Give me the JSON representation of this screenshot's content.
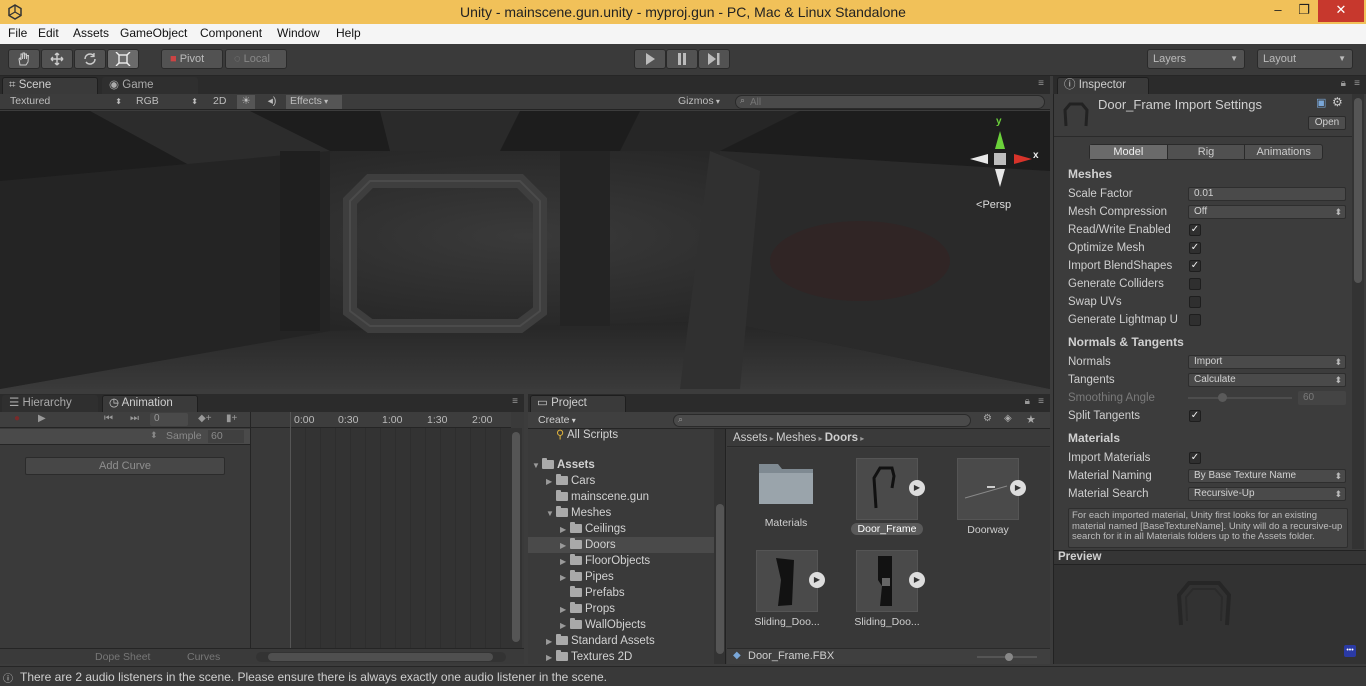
{
  "window": {
    "title": "Unity - mainscene.gun.unity - myproj.gun - PC, Mac & Linux Standalone",
    "min": "–",
    "max": "❐",
    "close": "✕"
  },
  "menu": [
    "File",
    "Edit",
    "Assets",
    "GameObject",
    "Component",
    "Window",
    "Help"
  ],
  "toolbar": {
    "pivot": "Pivot",
    "local": "Local",
    "layers": "Layers",
    "layout": "Layout"
  },
  "scene": {
    "tabs": {
      "scene": "Scene",
      "game": "Game"
    },
    "render_mode": "Textured",
    "color_mode": "RGB",
    "mode2d": "2D",
    "effects": "Effects",
    "gizmos": "Gizmos",
    "search_placeholder": "All",
    "persp": "Persp",
    "axis_x": "x",
    "axis_y": "y"
  },
  "animation": {
    "tabs": {
      "hierarchy": "Hierarchy",
      "animation": "Animation"
    },
    "frame": "0",
    "sample_label": "Sample",
    "sample_value": "60",
    "add_curve": "Add Curve",
    "timeline": [
      "0:00",
      "0:30",
      "1:00",
      "1:30",
      "2:00"
    ],
    "dope_sheet": "Dope Sheet",
    "curves": "Curves"
  },
  "project": {
    "tab": "Project",
    "create": "Create",
    "breadcrumb": [
      "Assets",
      "Meshes",
      "Doors"
    ],
    "tree": {
      "all_scripts": "All Scripts",
      "assets": "Assets",
      "cars": "Cars",
      "mainscene": "mainscene.gun",
      "meshes": "Meshes",
      "ceilings": "Ceilings",
      "doors": "Doors",
      "floorobjects": "FloorObjects",
      "pipes": "Pipes",
      "prefabs": "Prefabs",
      "props": "Props",
      "wallobjects": "WallObjects",
      "standard_assets": "Standard Assets",
      "textures2d": "Textures 2D"
    },
    "grid": [
      "Materials",
      "Door_Frame",
      "Doorway",
      "Sliding_Doo...",
      "Sliding_Doo..."
    ],
    "selected_file": "Door_Frame.FBX"
  },
  "inspector": {
    "tab": "Inspector",
    "title": "Door_Frame Import Settings",
    "open": "Open",
    "tabs": [
      "Model",
      "Rig",
      "Animations"
    ],
    "meshes_header": "Meshes",
    "scale_factor_label": "Scale Factor",
    "scale_factor": "0.01",
    "mesh_compression_label": "Mesh Compression",
    "mesh_compression": "Off",
    "read_write_label": "Read/Write Enabled",
    "optimize_mesh_label": "Optimize Mesh",
    "import_blend_label": "Import BlendShapes",
    "gen_colliders_label": "Generate Colliders",
    "swap_uvs_label": "Swap UVs",
    "gen_lightmap_label": "Generate Lightmap U",
    "normals_header": "Normals & Tangents",
    "normals_label": "Normals",
    "normals": "Import",
    "tangents_label": "Tangents",
    "tangents": "Calculate",
    "smoothing_label": "Smoothing Angle",
    "smoothing_value": "60",
    "smoothing_fraction": 0.33,
    "split_tangents_label": "Split Tangents",
    "materials_header": "Materials",
    "import_materials_label": "Import Materials",
    "material_naming_label": "Material Naming",
    "material_naming": "By Base Texture Name",
    "material_search_label": "Material Search",
    "material_search": "Recursive-Up",
    "help_text": "For each imported material, Unity first looks for an existing material named [BaseTextureName]. Unity will do a recursive-up search for it in all Materials folders up to the Assets folder.",
    "preview_header": "Preview"
  },
  "status": "There are 2 audio listeners in the scene. Please ensure there is always exactly one audio listener in the scene."
}
